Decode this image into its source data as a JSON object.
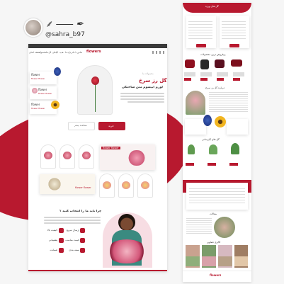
{
  "brand": {
    "handle": "@sahra_b97",
    "logo_text": "flowers",
    "accent": "#b8192f"
  },
  "nav": {
    "items": [
      "صفحه اصلی",
      "محصولات",
      "گل ها",
      "گیاهان",
      "هدیه",
      "درباره ما",
      "تماس با ما"
    ]
  },
  "hero": {
    "eyebrow": "محصولات ما",
    "title": "گل رز سرخ",
    "subtitle": "لورم ایپسوم متن ساختگی",
    "primary_btn": "خرید",
    "secondary_btn": "مشاهده بیشتر",
    "side_cards": [
      {
        "title": "flower",
        "sub": "flower flower"
      },
      {
        "title": "flower",
        "sub": "flower flower"
      },
      {
        "title": "flower",
        "sub": "flower flower"
      }
    ]
  },
  "banner": {
    "label": "flower flower"
  },
  "banner2": {
    "label": "flower flower"
  },
  "why": {
    "title": "چرا باید ما را انتخاب کنید ؟",
    "features": [
      "کیفیت بالا",
      "ارسال سریع",
      "پشتیبانی",
      "قیمت مناسب",
      "ضمانت",
      "بسته بندی"
    ]
  },
  "right_panel": {
    "top_title": "گل های ویژه",
    "section2": "پرفروش ترین محصولات",
    "section3": "درباره گل رز سرخ",
    "section4": "گل های آپارتمانی",
    "section5": "مقالات",
    "section6": "گالری تصاویر"
  }
}
